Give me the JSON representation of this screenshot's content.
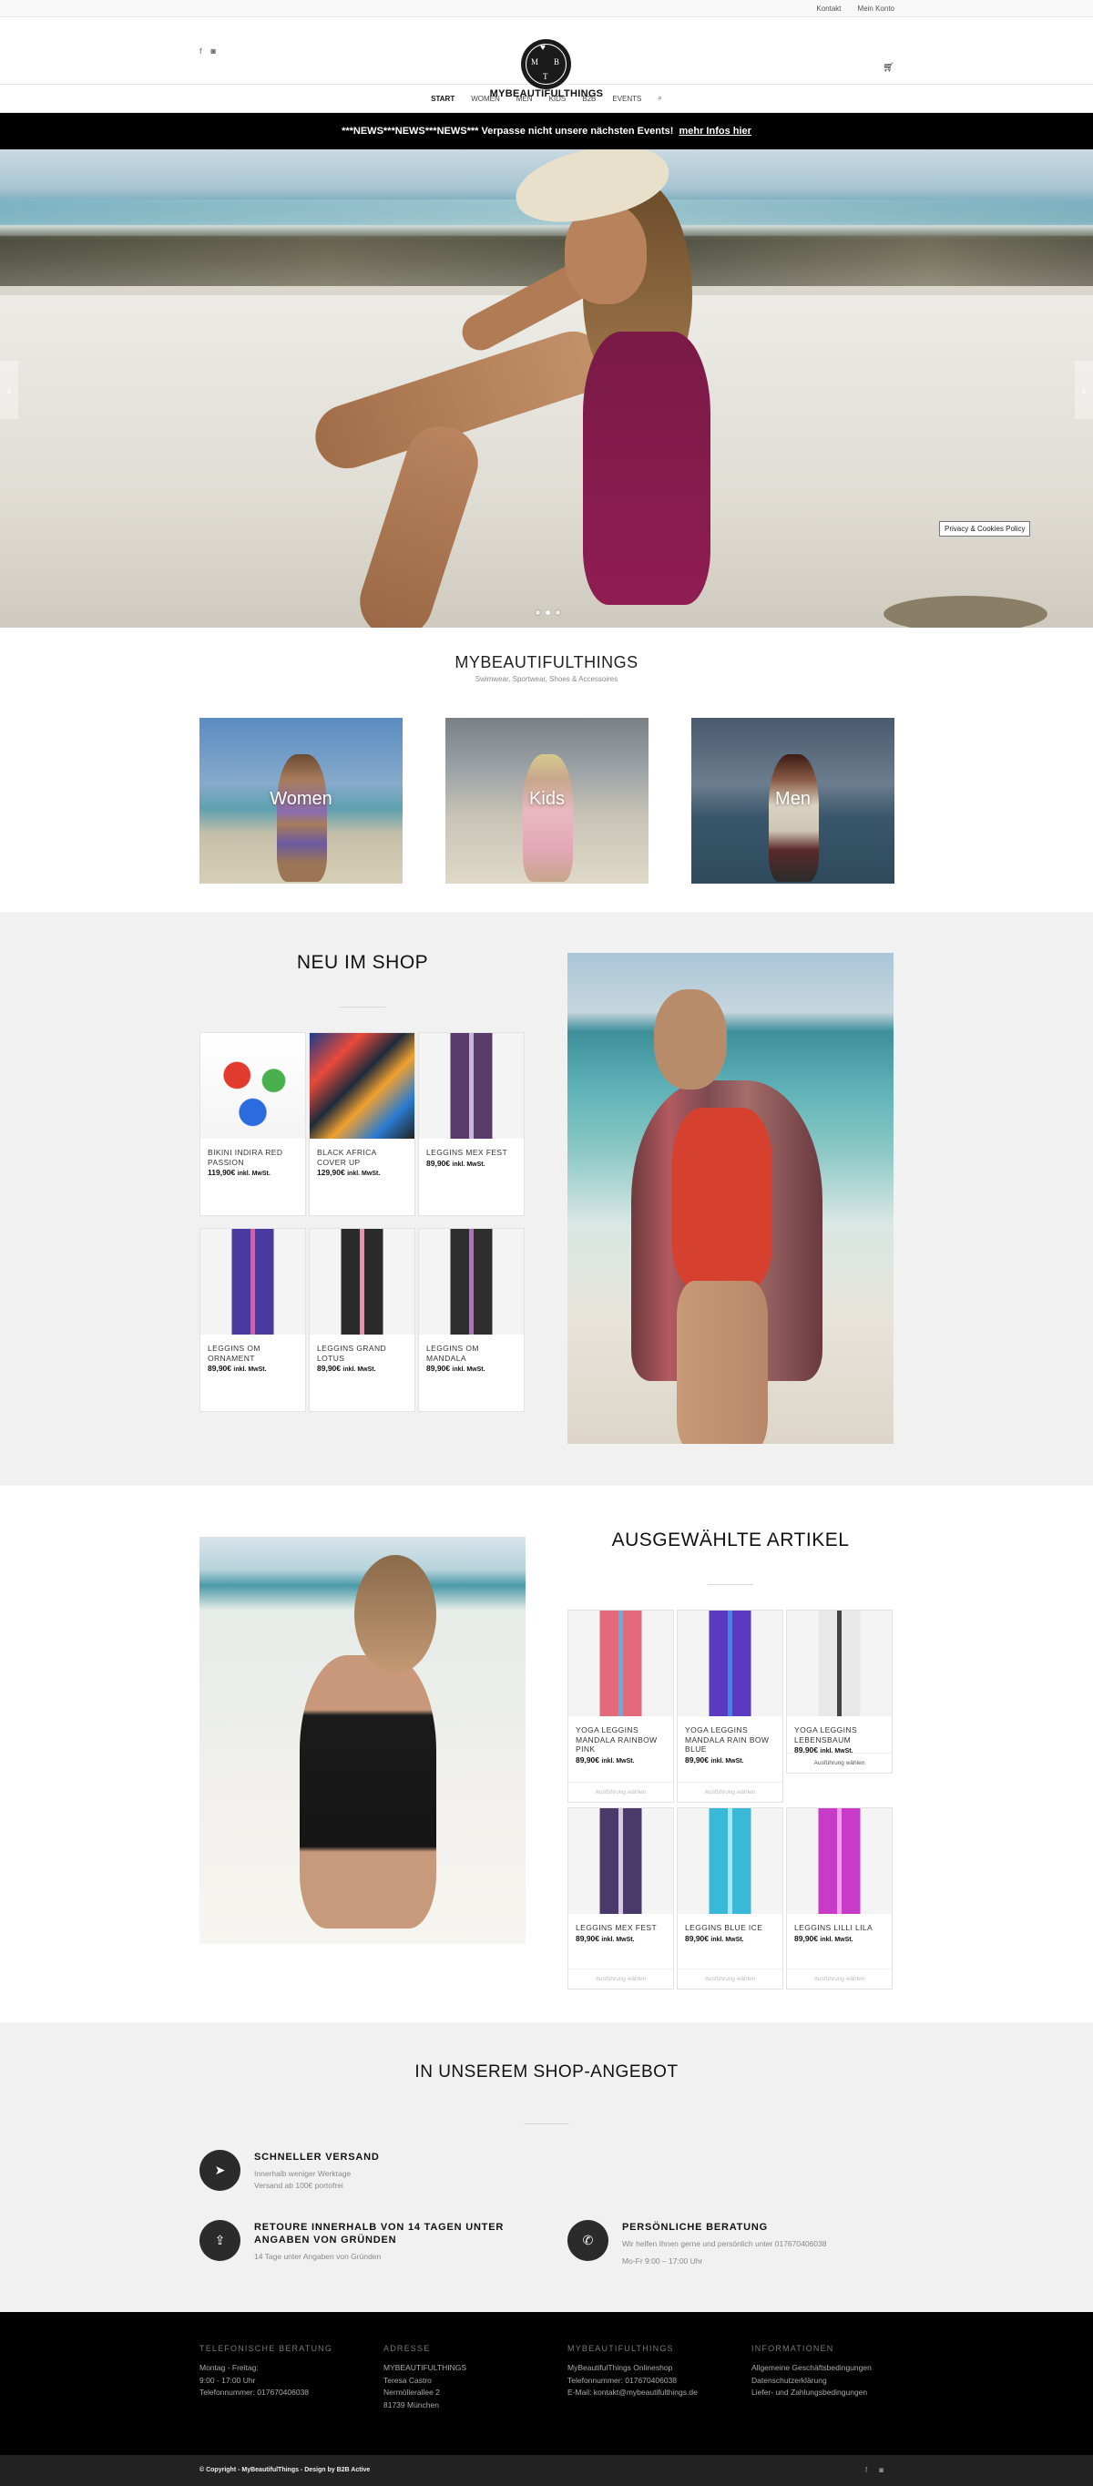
{
  "topbar": {
    "links": [
      "Kontakt",
      "Mein Konto"
    ]
  },
  "header": {
    "social_icons": [
      "facebook-icon",
      "instagram-icon"
    ],
    "logo_letters": [
      "M",
      "B",
      "T"
    ],
    "logo_text": "MYBEAUTIFULTHINGS",
    "cart_icon": "cart-icon"
  },
  "nav": {
    "items": [
      "START",
      "WOMEN",
      "MEN",
      "KIDS",
      "B2B",
      "EVENTS"
    ],
    "active": "START",
    "search_icon": "search-icon"
  },
  "news": {
    "text": "***NEWS***NEWS***NEWS*** Verpasse nicht unsere nächsten Events!",
    "link": "mehr Infos hier"
  },
  "hero": {
    "prev": "‹",
    "next": "›",
    "slides": 3,
    "active_slide": 2,
    "privacy": "Privacy & Cookies Policy"
  },
  "brand": {
    "title": "MYBEAUTIFULTHINGS",
    "subtitle": "Swimwear, Sportwear, Shoes & Accessoires"
  },
  "categories": [
    "Women",
    "Kids",
    "Men"
  ],
  "neu": {
    "title": "NEU IM SHOP",
    "products": [
      {
        "name": "BIKINI INDIRA RED PASSION",
        "price": "119,90€",
        "tax": "inkl. MwSt."
      },
      {
        "name": "BLACK AFRICA COVER UP",
        "price": "129,90€",
        "tax": "inkl. MwSt."
      },
      {
        "name": "LEGGINS MEX FEST",
        "price": "89,90€",
        "tax": "inkl. MwSt."
      },
      {
        "name": "LEGGINS OM ORNAMENT",
        "price": "89,90€",
        "tax": "inkl. MwSt."
      },
      {
        "name": "LEGGINS GRAND LOTUS",
        "price": "89,90€",
        "tax": "inkl. MwSt."
      },
      {
        "name": "LEGGINS OM MANDALA",
        "price": "89,90€",
        "tax": "inkl. MwSt."
      }
    ]
  },
  "ausgewaehlt": {
    "title": "AUSGEWÄHLTE ARTIKEL",
    "products": [
      {
        "name": "YOGA LEGGINS MANDALA RAINBOW PINK",
        "price": "89,90€",
        "tax": "inkl. MwSt.",
        "cta": "Ausführung wählen"
      },
      {
        "name": "YOGA LEGGINS MANDALA RAIN BOW BLUE",
        "price": "89,90€",
        "tax": "inkl. MwSt.",
        "cta": "Ausführung wählen"
      },
      {
        "name": "YOGA LEGGINS LEBENSBAUM",
        "price": "89,90€",
        "tax": "inkl. MwSt.",
        "cta": "Ausführung wählen"
      },
      {
        "name": "LEGGINS MEX FEST",
        "price": "89,90€",
        "tax": "inkl. MwSt.",
        "cta": "Ausführung wählen"
      },
      {
        "name": "LEGGINS BLUE ICE",
        "price": "89,90€",
        "tax": "inkl. MwSt.",
        "cta": "Ausführung wählen"
      },
      {
        "name": "LEGGINS LILLI LILA",
        "price": "89,90€",
        "tax": "inkl. MwSt.",
        "cta": "Ausführung wählen"
      }
    ]
  },
  "angebot": {
    "title": "IN UNSEREM SHOP-ANGEBOT",
    "features": [
      {
        "icon": "paper-plane-icon",
        "title": "SCHNELLER VERSAND",
        "lines": [
          "Innerhalb weniger Werktage",
          "Versand ab 100€ portofrei"
        ]
      },
      {
        "icon": "upload-icon",
        "title": "RETOURE INNERHALB VON 14 TAGEN UNTER ANGABEN VON GRÜNDEN",
        "lines": [
          "14 Tage unter Angaben von Gründen"
        ]
      },
      {
        "icon": "phone-icon",
        "title": "PERSÖNLICHE BERATUNG",
        "lines": [
          "Wir helfen Ihnen gerne und persönlich unter 017670406038",
          "Mo-Fr 9:00 – 17:00 Uhr"
        ]
      }
    ]
  },
  "footer": {
    "cols": [
      {
        "title": "TELEFONISCHE BERATUNG",
        "lines": [
          "Montag - Freitag:",
          "9:00 - 17:00 Uhr",
          "Telefonnummer: 017670406038"
        ]
      },
      {
        "title": "ADRESSE",
        "lines": [
          "MYBEAUTIFULTHINGS",
          "Teresa Castro",
          "Nermöllerallee 2",
          "81739 München"
        ]
      },
      {
        "title": "MYBEAUTIFULTHINGS",
        "lines": [
          "MyBeautifulThings Onlineshop",
          "Telefonnummer: 017670406038",
          "E-Mail: kontakt@mybeautifulthings.de"
        ]
      },
      {
        "title": "INFORMATIONEN",
        "lines": [
          "Allgemeine Geschäftsbedingungen",
          "Datenschutzerklärung",
          "Liefer- und Zahlungsbedingungen"
        ]
      }
    ],
    "copyright": "© Copyright - MyBeautifulThings - Design by B2B Active",
    "social_icons": [
      "facebook-icon",
      "instagram-icon"
    ]
  }
}
